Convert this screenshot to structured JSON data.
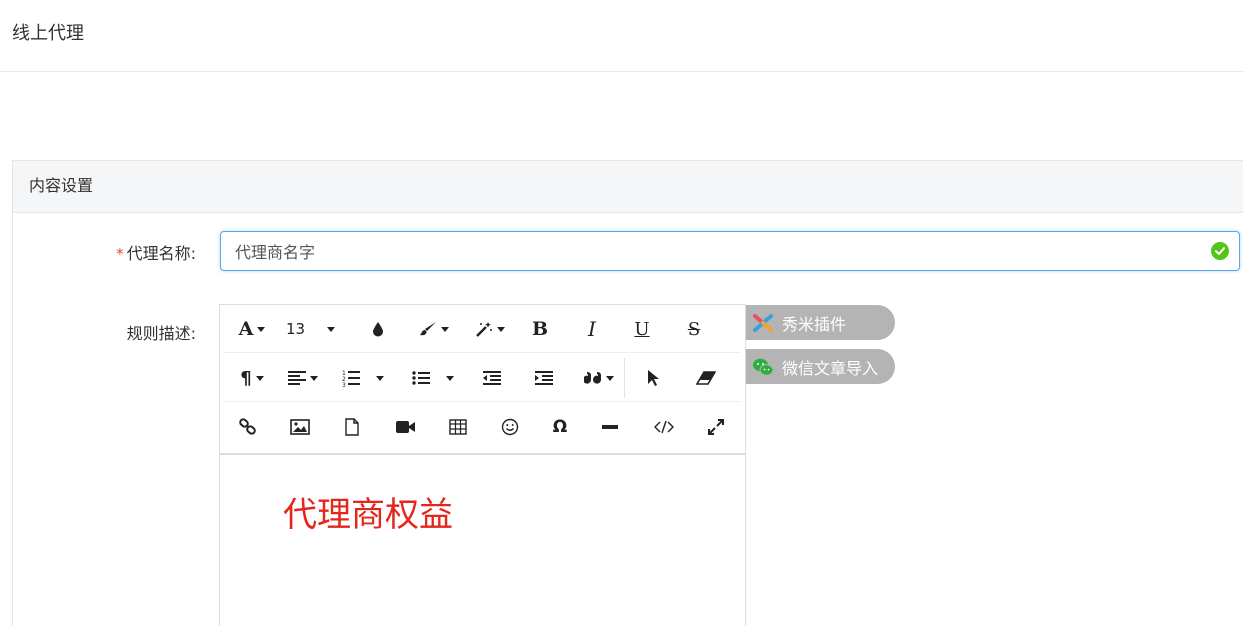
{
  "header": {
    "title": "线上代理"
  },
  "panel": {
    "title": "内容设置"
  },
  "form": {
    "name_label": "代理名称:",
    "name_required_mark": "*",
    "name_value": "代理商名字",
    "rules_label": "规则描述:"
  },
  "editor": {
    "font_size": "13",
    "content": "代理商权益",
    "content_color": "#e5261d",
    "toolbar_row1": [
      "font-color-icon",
      "font-size-select",
      "fill-color-icon",
      "paragraph-color-icon",
      "inline-style-icon",
      "bold-icon",
      "italic-icon",
      "underline-icon",
      "strikethrough-icon"
    ],
    "toolbar_row2": [
      "paragraph-format-icon",
      "align-icon",
      "ordered-list-icon",
      "unordered-list-icon",
      "outdent-icon",
      "indent-icon",
      "quote-icon",
      "select-all-icon",
      "clear-format-icon"
    ],
    "toolbar_row3": [
      "link-icon",
      "image-icon",
      "file-icon",
      "video-icon",
      "table-icon",
      "emoji-icon",
      "special-char-icon",
      "horizontal-line-icon",
      "code-view-icon",
      "fullscreen-icon"
    ]
  },
  "plugins": {
    "xiumi_label": "秀米插件",
    "wechat_label": "微信文章导入"
  },
  "colors": {
    "accent": "#5aa8e8",
    "valid": "#52c41a",
    "required": "#e64343",
    "plugin_bg": "#b4b4b4"
  }
}
